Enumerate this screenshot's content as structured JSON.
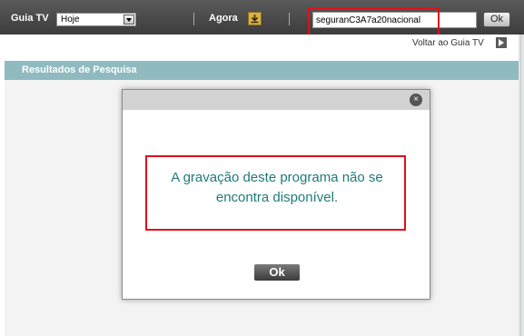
{
  "topbar": {
    "guide_label": "Guia TV",
    "day_select": "Hoje",
    "now_label": "Agora",
    "search_value": "seguranC3A7a20nacional",
    "search_ok_label": "Ok"
  },
  "nav": {
    "back_label": "Voltar ao Guia TV"
  },
  "results": {
    "title": "Resultados de Pesquisa"
  },
  "dialog": {
    "message_line1": "A gravação deste programa não se",
    "message_line2": "encontra disponível.",
    "ok_label": "Ok",
    "close_symbol": "×"
  },
  "colors": {
    "topbar": "#464646",
    "results_bar": "#8fbac0",
    "message_text": "#1f7a7a",
    "highlight": "#e0101a"
  }
}
